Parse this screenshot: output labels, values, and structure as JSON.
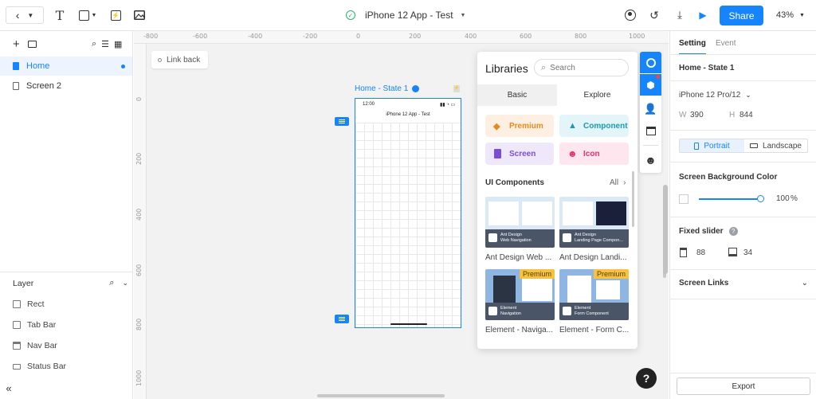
{
  "topbar": {
    "title": "iPhone 12 App - Test",
    "share_label": "Share",
    "zoom": "43%"
  },
  "left": {
    "pages": [
      {
        "label": "Home",
        "active": true
      },
      {
        "label": "Screen 2",
        "active": false
      }
    ],
    "layer_header": "Layer",
    "layers": [
      {
        "label": "Rect",
        "icon": "rect-icon"
      },
      {
        "label": "Tab Bar",
        "icon": "tab-bar-icon"
      },
      {
        "label": "Nav Bar",
        "icon": "nav-bar-icon"
      },
      {
        "label": "Status Bar",
        "icon": "status-bar-icon"
      }
    ]
  },
  "canvas": {
    "ruler_top": [
      "-800",
      "-600",
      "-400",
      "-200",
      "0",
      "200",
      "400",
      "600",
      "800",
      "1000"
    ],
    "ruler_left": [
      "0",
      "200",
      "400",
      "600",
      "800",
      "1000"
    ],
    "link_back": "Link back",
    "frame_label": "Home - State 1",
    "phone_time": "12:00",
    "phone_title": "iPhone 12 App - Test"
  },
  "libraries": {
    "title": "Libraries",
    "search_placeholder": "Search",
    "tabs": [
      "Basic",
      "Explore"
    ],
    "categories": [
      {
        "label": "Premium",
        "color": "#e98a1c",
        "bg": "#fdf0e3"
      },
      {
        "label": "Component",
        "color": "#1a9bb5",
        "bg": "#e3f5f8"
      },
      {
        "label": "Screen",
        "color": "#7a4fd6",
        "bg": "#efe8fb"
      },
      {
        "label": "Icon",
        "color": "#e0336b",
        "bg": "#fde6ee"
      }
    ],
    "section_title": "UI Components",
    "all_label": "All",
    "items": [
      {
        "caption": "Ant Design Web ...",
        "sub1": "Ant Design",
        "sub2": "Web Navigation",
        "premium": false
      },
      {
        "caption": "Ant Design Landi...",
        "sub1": "Ant Design",
        "sub2": "Landing Page Compon...",
        "premium": false
      },
      {
        "caption": "Element - Naviga...",
        "sub1": "Element",
        "sub2": "Navigation",
        "premium": true
      },
      {
        "caption": "Element - Form C...",
        "sub1": "Element",
        "sub2": "Form Component",
        "premium": true
      }
    ],
    "premium_tag": "Premium"
  },
  "right": {
    "tabs": [
      "Setting",
      "Event"
    ],
    "state_name": "Home - State 1",
    "device": "iPhone 12 Pro/12",
    "w_label": "W",
    "w_value": "390",
    "h_label": "H",
    "h_value": "844",
    "orientation": [
      "Portrait",
      "Landscape"
    ],
    "bg_color_title": "Screen Background Color",
    "opacity_value": "100",
    "opacity_unit": "%",
    "fixed_slider_title": "Fixed slider",
    "fixed_top": "88",
    "fixed_bottom": "34",
    "screen_links": "Screen Links",
    "export_label": "Export"
  },
  "help_label": "?",
  "colors": {
    "accent": "#1684fc"
  }
}
